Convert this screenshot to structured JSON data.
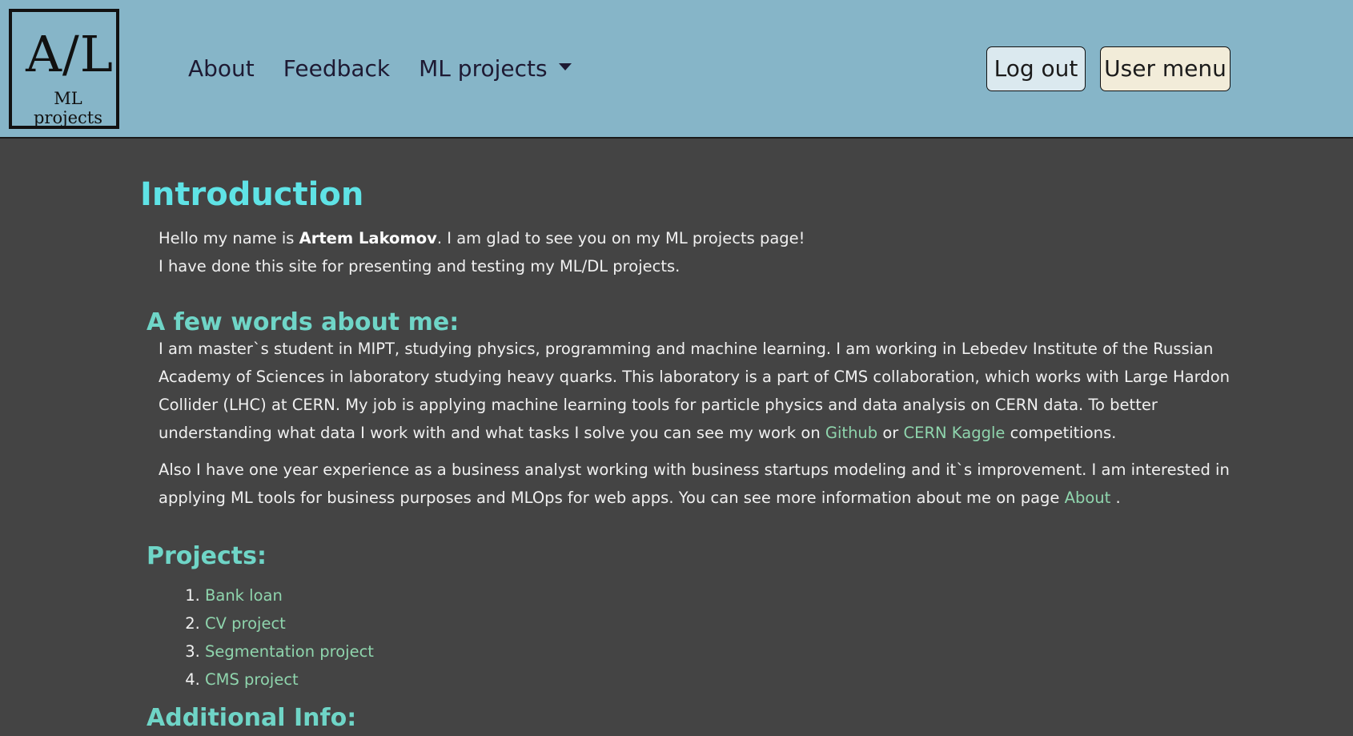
{
  "logo": {
    "mark": "A/L",
    "subtitle": "ML projects"
  },
  "nav": {
    "about": "About",
    "feedback": "Feedback",
    "ml_projects": "ML projects"
  },
  "buttons": {
    "logout": "Log out",
    "user_menu": "User menu"
  },
  "intro": {
    "title": "Introduction",
    "line1_pre": "Hello my name is ",
    "name": "Artem Lakomov",
    "line1_post": ". I am glad to see you on my ML projects page!",
    "line2": "I have done this site for presenting and testing my ML/DL projects."
  },
  "about_me": {
    "title": "A few words about me:",
    "p1_text": "I am master`s student in MIPT, studying physics, programming and machine learning. I am working in Lebedev Institute of the Russian Academy of Sciences in laboratory studying heavy quarks. This laboratory is a part of CMS collaboration, which works with Large Hardon Collider (LHC) at CERN. My job is applying machine learning tools for particle physics and data analysis on CERN data. To better understanding what data I work with and what tasks I solve you can see my work on ",
    "github_link": "Github",
    "p1_or": " or ",
    "kaggle_link": "CERN Kaggle",
    "p1_end": " competitions.",
    "p2_text": "Also I have one year experience as a business analyst working with business startups modeling and it`s improvement. I am interested in applying ML tools for business purposes and MLOps for web apps. You can see more information about me on page ",
    "about_link": "About",
    "p2_end": " ."
  },
  "projects": {
    "title": "Projects:",
    "items": [
      "Bank loan",
      "CV project",
      "Segmentation project",
      "CMS project"
    ]
  },
  "additional": {
    "title": "Additional Info:"
  },
  "colors": {
    "navbar_bg": "#86b5c8",
    "page_bg": "#444444",
    "heading": "#5fe3e6",
    "subheading": "#6fd5c7",
    "link": "#8fd5ad"
  }
}
